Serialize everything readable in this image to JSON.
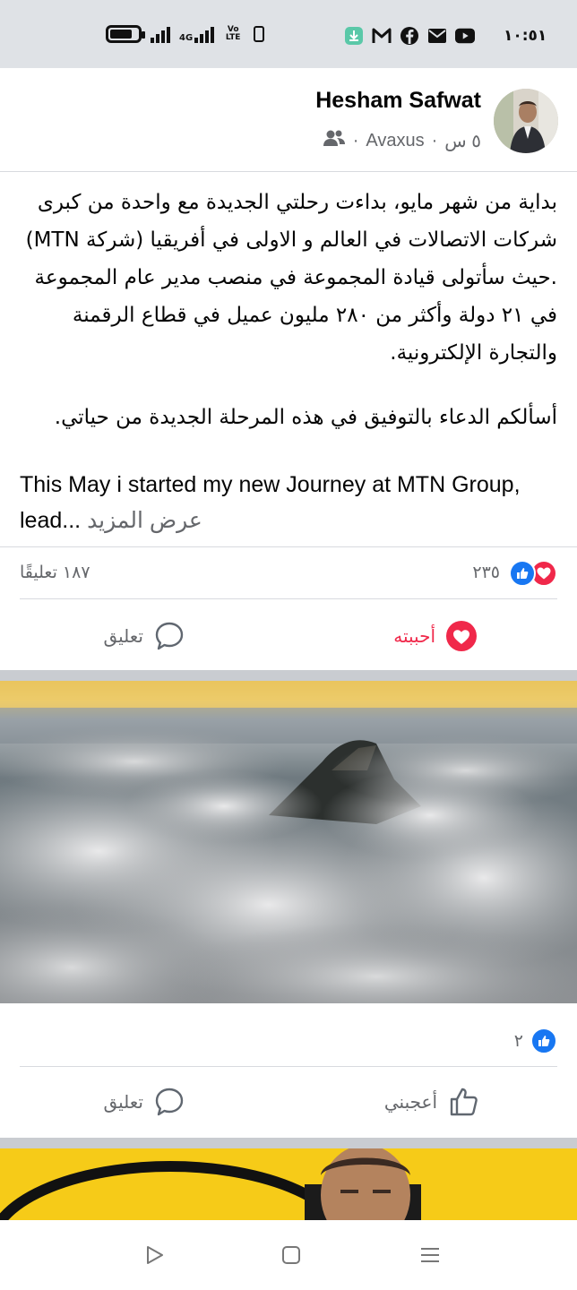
{
  "status_bar": {
    "time": "١٠:٥١",
    "network_type": "4G",
    "volte_label": "Vo LTE",
    "icons": [
      "battery-icon",
      "signal-icon",
      "signal-4g-icon",
      "volte-icon",
      "vibrate-icon",
      "download-notification-icon",
      "gmail-icon",
      "facebook-icon",
      "mail-icon",
      "youtube-icon"
    ]
  },
  "post1": {
    "author": "Hesham Safwat",
    "time_ago": "٥ س",
    "page_name": "Avaxus",
    "separator": "·",
    "audience_icon": "friends-icon",
    "arabic_paragraph_1": "بداية من شهر مايو، بداءت رحلتي الجديدة مع واحدة من كبرى شركات الاتصالات في العالم و الاولى في أفريقيا (شركة MTN) .حيث سأتولى قيادة المجموعة في منصب مدير عام المجموعة في ٢١ دولة وأكثر من ٢٨٠ مليون عميل في قطاع الرقمنة والتجارة الإلكترونية.",
    "arabic_paragraph_2": "أسألكم الدعاء بالتوفيق في هذه المرحلة الجديدة من حياتي.",
    "english_text": "This May i started my new Journey at MTN Group, lead...",
    "see_more": "عرض المزيد",
    "reaction_count": "٢٣٥",
    "comment_count": "١٨٧ تعليقًا",
    "love_label": "أحببته",
    "comment_label": "تعليق",
    "love_color": "#f0284a",
    "like_color": "#1877f2"
  },
  "post2": {
    "reaction_count": "٢",
    "like_label": "أعجبني",
    "comment_label": "تعليق"
  },
  "nav": {
    "icons": [
      "back-icon",
      "home-icon",
      "recents-icon"
    ]
  }
}
